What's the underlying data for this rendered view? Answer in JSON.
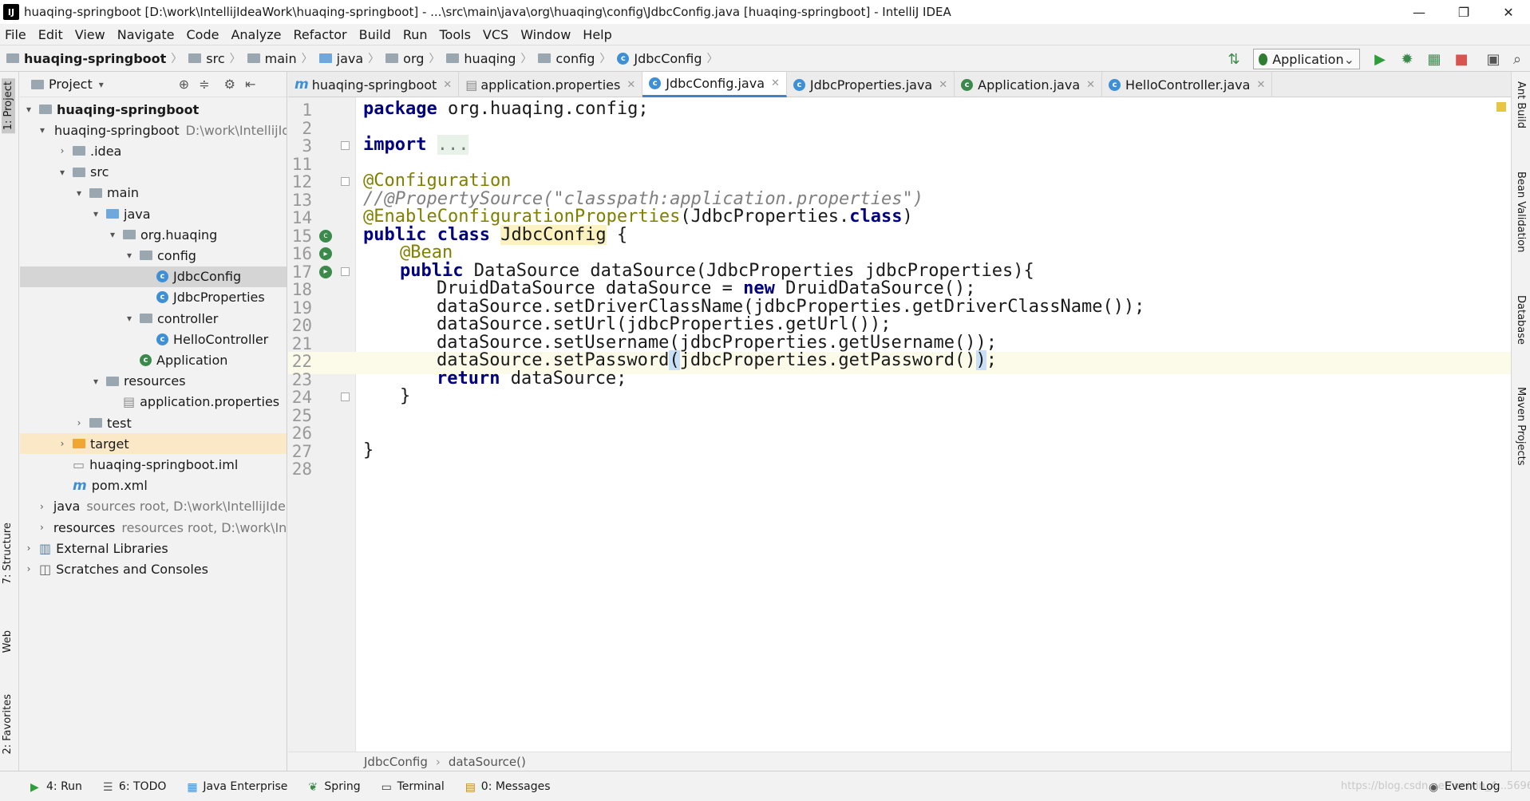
{
  "window": {
    "title": "huaqing-springboot [D:\\work\\IntellijIdeaWork\\huaqing-springboot] - ...\\src\\main\\java\\org\\huaqing\\config\\JdbcConfig.java [huaqing-springboot] - IntelliJ IDEA",
    "app_icon": "IJ",
    "minimize": "—",
    "maximize": "❐",
    "close": "✕"
  },
  "menu": [
    "File",
    "Edit",
    "View",
    "Navigate",
    "Code",
    "Analyze",
    "Refactor",
    "Build",
    "Run",
    "Tools",
    "VCS",
    "Window",
    "Help"
  ],
  "breadcrumbs": [
    "huaqing-springboot",
    "src",
    "main",
    "java",
    "org",
    "huaqing",
    "config",
    "JdbcConfig"
  ],
  "run_config": {
    "label": "Application",
    "dropdown": "⌄"
  },
  "project_panel": {
    "title": "Project",
    "rows": [
      {
        "label": "huaqing-springboot",
        "extra": "",
        "bold": true
      },
      {
        "label": "huaqing-springboot",
        "extra": "D:\\work\\IntellijIdeaWork\\huaqing-springboot"
      },
      {
        "label": ".idea",
        "extra": ""
      },
      {
        "label": "src",
        "extra": ""
      },
      {
        "label": "main",
        "extra": ""
      },
      {
        "label": "java",
        "extra": ""
      },
      {
        "label": "org.huaqing",
        "extra": ""
      },
      {
        "label": "config",
        "extra": ""
      },
      {
        "label": "JdbcConfig",
        "extra": ""
      },
      {
        "label": "JdbcProperties",
        "extra": ""
      },
      {
        "label": "controller",
        "extra": ""
      },
      {
        "label": "HelloController",
        "extra": ""
      },
      {
        "label": "Application",
        "extra": ""
      },
      {
        "label": "resources",
        "extra": ""
      },
      {
        "label": "application.properties",
        "extra": ""
      },
      {
        "label": "test",
        "extra": ""
      },
      {
        "label": "target",
        "extra": ""
      },
      {
        "label": "huaqing-springboot.iml",
        "extra": ""
      },
      {
        "label": "pom.xml",
        "extra": ""
      },
      {
        "label": "java",
        "extra": "sources root,  D:\\work\\IntellijIdeaWork"
      },
      {
        "label": "resources",
        "extra": "resources root,  D:\\work\\IntellijIdeaWork"
      },
      {
        "label": "External Libraries",
        "extra": ""
      },
      {
        "label": "Scratches and Consoles",
        "extra": ""
      }
    ]
  },
  "tabs": [
    {
      "label": "huaqing-springboot",
      "icon": "m"
    },
    {
      "label": "application.properties",
      "icon": "properties-icon"
    },
    {
      "label": "JdbcConfig.java",
      "icon": "c",
      "active": true
    },
    {
      "label": "JdbcProperties.java",
      "icon": "c"
    },
    {
      "label": "Application.java",
      "icon": "c"
    },
    {
      "label": "HelloController.java",
      "icon": "c"
    }
  ],
  "code": {
    "line_numbers": [
      "1",
      "2",
      "3",
      "11",
      "12",
      "13",
      "14",
      "15",
      "16",
      "17",
      "18",
      "19",
      "20",
      "21",
      "22",
      "23",
      "24",
      "25",
      "26",
      "27",
      "28"
    ],
    "current_line": "22",
    "lines": {
      "l1_kw": "package",
      "l1_rest": " org.huaqing.config;",
      "l3_kw": "import",
      "l3_fold": "...",
      "l12": "@Configuration",
      "l13": "//@PropertySource(\"classpath:application.properties\")",
      "l14_ann": "@EnableConfigurationProperties",
      "l14_a": "(JdbcProperties.",
      "l14_kw": "class",
      "l14_b": ")",
      "l15_kw": "public class",
      "l15_name": "JdbcConfig",
      "l15_rest": " {",
      "l16": "@Bean",
      "l17_kw": "public",
      "l17_rest": " DataSource dataSource(JdbcProperties jdbcProperties){",
      "l18_a": "DruidDataSource dataSource = ",
      "l18_kw": "new",
      "l18_b": " DruidDataSource();",
      "l19": "dataSource.setDriverClassName(jdbcProperties.getDriverClassName());",
      "l20": "dataSource.setUrl(jdbcProperties.getUrl());",
      "l21": "dataSource.setUsername(jdbcProperties.getUsername());",
      "l22_a": "dataSource.setPassword",
      "l22_p1": "(",
      "l22_b": "jdbcProperties.getPassword()",
      "l22_p2": ")",
      "l22_c": ";",
      "l23_kw": "return",
      "l23_rest": " dataSource;",
      "l24": "}",
      "l27": "}"
    }
  },
  "editor_breadcrumb": [
    "JdbcConfig",
    "dataSource()"
  ],
  "left_tools": [
    "1: Project",
    "7: Structure",
    "Web",
    "2: Favorites"
  ],
  "right_tools": [
    "Ant Build",
    "Bean Validation",
    "Database",
    "Maven Projects"
  ],
  "bottom_tools": [
    "4: Run",
    "6: TODO",
    "Java Enterprise",
    "Spring",
    "Terminal",
    "0: Messages"
  ],
  "event_log": "Event Log",
  "watermark": "https://blog.csdn.net/weixin_4...5696"
}
